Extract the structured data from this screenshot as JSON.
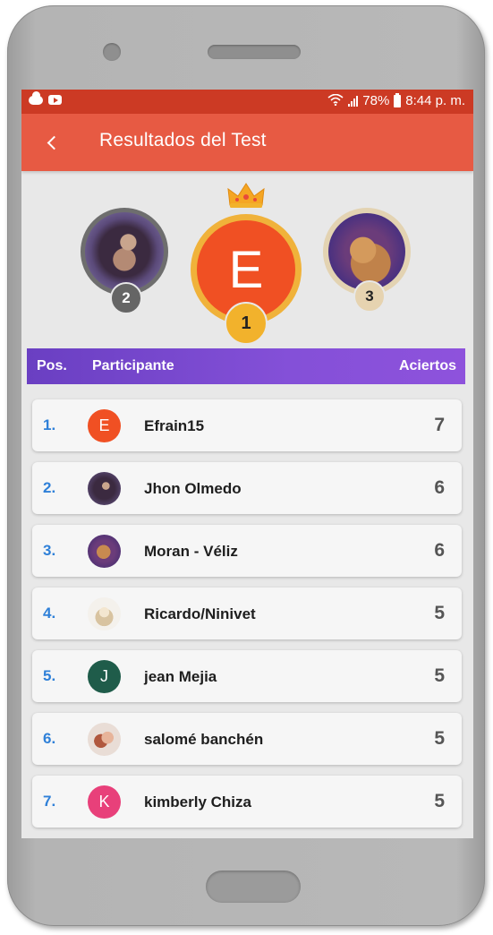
{
  "status_bar": {
    "battery": "78%",
    "time": "8:44 p. m."
  },
  "app_bar": {
    "title": "Resultados del Test",
    "back_icon": "back-arrow-icon"
  },
  "podium": {
    "first": {
      "rank": "1",
      "initial": "E",
      "color": "#f05023"
    },
    "second": {
      "rank": "2"
    },
    "third": {
      "rank": "3"
    }
  },
  "table": {
    "headers": {
      "position": "Pos.",
      "participant": "Participante",
      "hits": "Aciertos"
    },
    "rows": [
      {
        "pos": "1.",
        "name": "Efrain15",
        "score": "7",
        "avatar": {
          "type": "initial",
          "text": "E",
          "color": "#f05023"
        }
      },
      {
        "pos": "2.",
        "name": "Jhon Olmedo",
        "score": "6",
        "avatar": {
          "type": "photo"
        }
      },
      {
        "pos": "3.",
        "name": "Moran - Véliz",
        "score": "6",
        "avatar": {
          "type": "photo"
        }
      },
      {
        "pos": "4.",
        "name": "Ricardo/Ninivet",
        "score": "5",
        "avatar": {
          "type": "photo"
        }
      },
      {
        "pos": "5.",
        "name": "jean Mejia",
        "score": "5",
        "avatar": {
          "type": "initial",
          "text": "J",
          "color": "#1f5c4a"
        }
      },
      {
        "pos": "6.",
        "name": "salomé banchén",
        "score": "5",
        "avatar": {
          "type": "photo"
        }
      },
      {
        "pos": "7.",
        "name": "kimberly Chiza",
        "score": "5",
        "avatar": {
          "type": "initial",
          "text": "K",
          "color": "#e8407a"
        }
      }
    ]
  },
  "colors": {
    "status_bar": "#cc3a24",
    "app_bar": "#e75a43",
    "header_gradient_start": "#6a3fc2",
    "header_gradient_end": "#8e52dc",
    "position_text": "#2f80d8",
    "gold": "#f2b22c"
  }
}
